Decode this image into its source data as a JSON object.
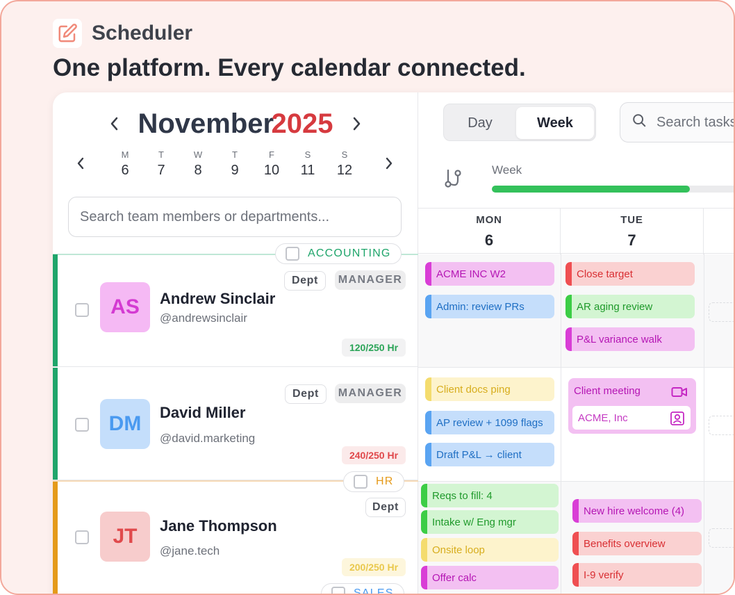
{
  "brand": {
    "name": "Scheduler",
    "icon": "edit-icon",
    "accent": "#f3a89b"
  },
  "headline": "One platform. Every calendar connected.",
  "calendar": {
    "month": "November",
    "year": "2025",
    "week_days": [
      {
        "letter": "M",
        "num": "6"
      },
      {
        "letter": "T",
        "num": "7"
      },
      {
        "letter": "W",
        "num": "8"
      },
      {
        "letter": "T",
        "num": "9"
      },
      {
        "letter": "F",
        "num": "10"
      },
      {
        "letter": "S",
        "num": "11"
      },
      {
        "letter": "S",
        "num": "12"
      }
    ]
  },
  "team_search": {
    "placeholder": "Search team members or departments..."
  },
  "departments": {
    "accounting": {
      "label": "ACCOUNTING",
      "color": "#1fa56b"
    },
    "hr": {
      "label": "HR",
      "color": "#e59a1a"
    },
    "sales": {
      "label": "SALES"
    }
  },
  "members": [
    {
      "initials": "AS",
      "name": "Andrew Sinclair",
      "handle": "@andrewsinclair",
      "dept_tag": "Dept",
      "role_tag": "MANAGER",
      "hours": "120/250 Hr"
    },
    {
      "initials": "DM",
      "name": "David Miller",
      "handle": "@david.marketing",
      "dept_tag": "Dept",
      "role_tag": "MANAGER",
      "hours": "240/250 Hr"
    },
    {
      "initials": "JT",
      "name": "Jane Thompson",
      "handle": "@jane.tech",
      "dept_tag": "Dept",
      "hours": "200/250 Hr"
    }
  ],
  "view_toggle": {
    "day": "Day",
    "week": "Week",
    "selected": "Week"
  },
  "task_search": {
    "placeholder": "Search tasks"
  },
  "progress": {
    "label": "Week",
    "fraction": 0.75
  },
  "columns": [
    {
      "dow": "MON",
      "num": "6"
    },
    {
      "dow": "TUE",
      "num": "7"
    }
  ],
  "events": {
    "andrew_mon": [
      "ACME INC W2",
      "Admin: review PRs"
    ],
    "andrew_tue": [
      "Close target",
      "AR aging review",
      "P&L variance walk"
    ],
    "david_mon": [
      "Client docs ping",
      "AP review + 1099 flags",
      "Draft P&L → client"
    ],
    "david_tue_meeting": {
      "title": "Client meeting",
      "client": "ACME, Inc"
    },
    "jane_mon": [
      "Reqs to fill: 4",
      "Intake w/ Eng mgr",
      "Onsite loop",
      "Offer calc"
    ],
    "jane_tue": [
      "New hire welcome (4)",
      "Benefits overview",
      "I-9 verify"
    ]
  }
}
